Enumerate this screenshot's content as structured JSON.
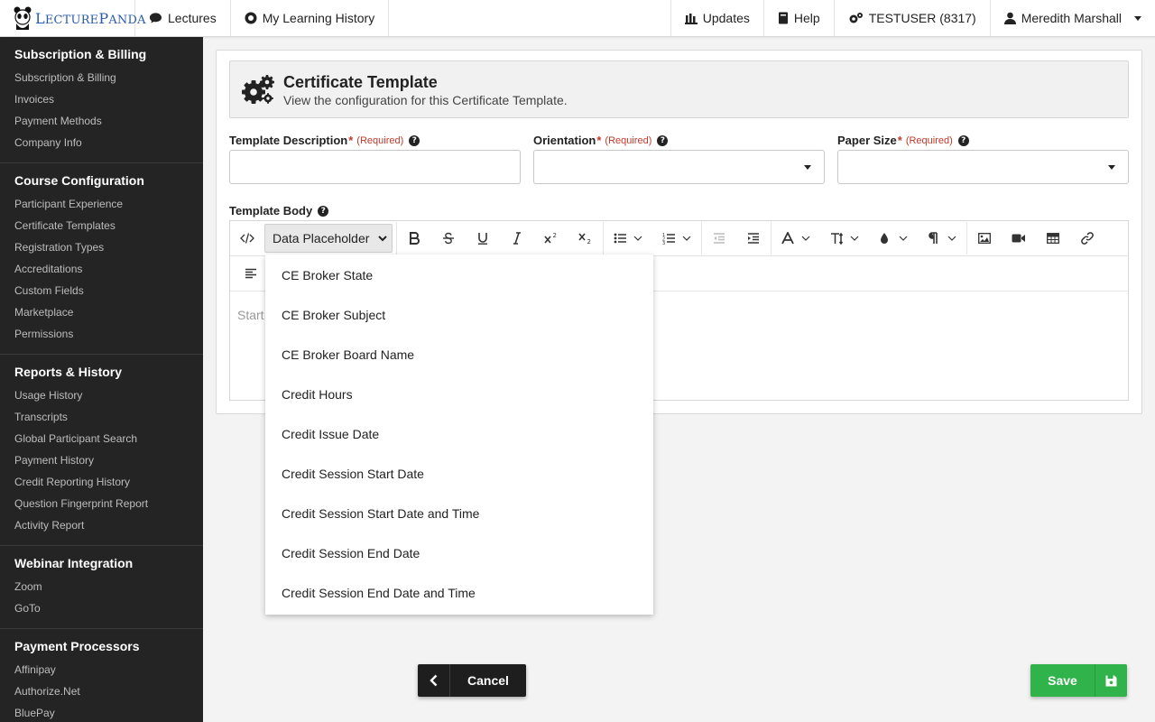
{
  "brand": {
    "logo_text_first": "L",
    "logo_text_rest": "ECTURE",
    "logo_text_first2": "P",
    "logo_text_rest2": "ANDA"
  },
  "topnav": {
    "lectures": "Lectures",
    "history": "My Learning History",
    "updates": "Updates",
    "help": "Help",
    "account": "TESTUSER (8317)",
    "user": "Meredith Marshall"
  },
  "sidebar": {
    "sections": [
      {
        "title": "Subscription & Billing",
        "items": [
          "Subscription & Billing",
          "Invoices",
          "Payment Methods",
          "Company Info"
        ]
      },
      {
        "title": "Course Configuration",
        "items": [
          "Participant Experience",
          "Certificate Templates",
          "Registration Types",
          "Accreditations",
          "Custom Fields",
          "Marketplace",
          "Permissions"
        ]
      },
      {
        "title": "Reports & History",
        "items": [
          "Usage History",
          "Transcripts",
          "Global Participant Search",
          "Payment History",
          "Credit Reporting History",
          "Question Fingerprint Report",
          "Activity Report"
        ]
      },
      {
        "title": "Webinar Integration",
        "items": [
          "Zoom",
          "GoTo"
        ]
      },
      {
        "title": "Payment Processors",
        "items": [
          "Affinipay",
          "Authorize.Net",
          "BluePay"
        ]
      }
    ]
  },
  "header": {
    "title": "Certificate Template",
    "subtitle": "View the configuration for this Certificate Template."
  },
  "form": {
    "template_description": {
      "label": "Template Description",
      "star": "*",
      "required": "(Required)",
      "value": ""
    },
    "orientation": {
      "label": "Orientation",
      "star": "*",
      "required": "(Required)",
      "value": ""
    },
    "paper_size": {
      "label": "Paper Size",
      "star": "*",
      "required": "(Required)",
      "value": ""
    },
    "template_body": {
      "label": "Template Body",
      "placeholder": "Start"
    }
  },
  "editor": {
    "placeholder_select": "Data Placeholder",
    "dropdown_options": [
      "CE Broker State",
      "CE Broker Subject",
      "CE Broker Board Name",
      "Credit Hours",
      "Credit Issue Date",
      "Credit Session Start Date",
      "Credit Session Start Date and Time",
      "Credit Session End Date",
      "Credit Session End Date and Time"
    ]
  },
  "actions": {
    "cancel": "Cancel",
    "save": "Save"
  },
  "colors": {
    "sidebar_bg": "#242424",
    "save_green": "#2fb34a",
    "required_red": "#c0392b",
    "brand_blue": "#2a5aa8"
  }
}
